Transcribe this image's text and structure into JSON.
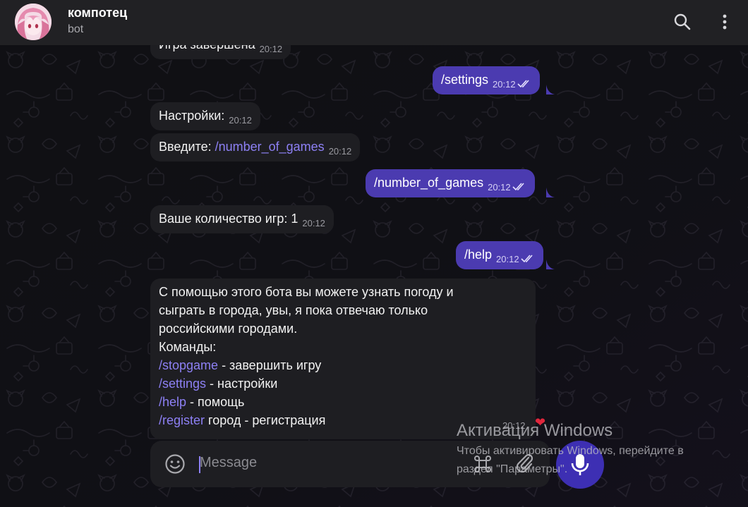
{
  "header": {
    "title": "компотец",
    "subtitle": "bot"
  },
  "messages": {
    "partial_top": {
      "text": "Игра завершена",
      "time": "20:12"
    },
    "settings_out": {
      "text": "/settings",
      "time": "20:12"
    },
    "settings_in": {
      "text": "Настройки:",
      "time": "20:12"
    },
    "enter_in": {
      "prefix": "Введите: ",
      "cmd": "/number_of_games",
      "time": "20:12"
    },
    "number_out": {
      "text": "/number_of_games",
      "time": "20:12"
    },
    "count_in": {
      "text": "Ваше количество игр: 1",
      "time": "20:12"
    },
    "help_out": {
      "text": "/help",
      "time": "20:12"
    },
    "help_in": {
      "line1": "С помощью этого бота вы можете узнать погоду и",
      "line2": "сыграть в города, увы, я пока отвечаю только",
      "line3": "российскими городами.",
      "line4": "Команды:",
      "cmd1": "/stopgame",
      "desc1": " - завершить игру",
      "cmd2": "/settings",
      "desc2": " - настройки",
      "cmd3": "/help",
      "desc3": " - помощь",
      "cmd4": "/register",
      "desc4": " город - регистрация",
      "time": "20:12",
      "reaction": "❤"
    }
  },
  "composer": {
    "placeholder": "Message"
  },
  "watermark": {
    "title": "Активация Windows",
    "line1": "Чтобы активировать Windows, перейдите в",
    "line2": "раздел \"Параметры\"."
  },
  "colors": {
    "accent": "#4b3bb0",
    "link": "#8d80f4",
    "bubble_in": "#1e1e22",
    "header": "#212124"
  },
  "icons": [
    "search-icon",
    "more-vert-icon",
    "emoji-icon",
    "command-icon",
    "attach-icon",
    "mic-icon",
    "double-check-icon"
  ]
}
